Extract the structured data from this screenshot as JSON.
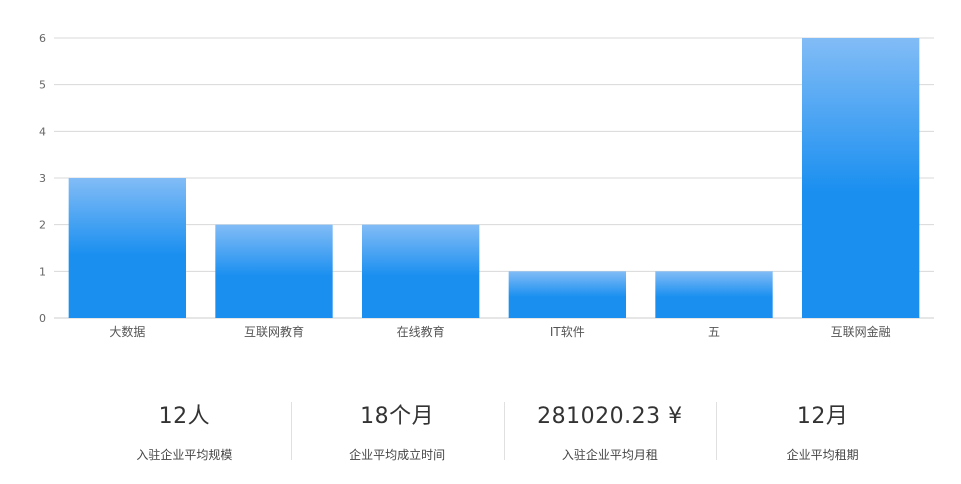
{
  "chart_data": {
    "type": "bar",
    "categories": [
      "大数据",
      "互联网教育",
      "在线教育",
      "IT软件",
      "五",
      "互联网金融"
    ],
    "values": [
      3,
      2,
      2,
      1,
      1,
      6
    ],
    "ylim": [
      0,
      6
    ],
    "yticks": [
      "0",
      "1",
      "2",
      "3",
      "4",
      "5",
      "6"
    ],
    "grid": true,
    "colors": {
      "bar_top": "#82bcf6",
      "bar_bottom": "#1a8ff0",
      "grid": "#d8d8d8",
      "axis": "#cccccc"
    }
  },
  "stats": [
    {
      "value": "12人",
      "label": "入驻企业平均规模"
    },
    {
      "value": "18个月",
      "label": "企业平均成立时间"
    },
    {
      "value": "281020.23 ¥",
      "label": "入驻企业平均月租"
    },
    {
      "value": "12月",
      "label": "企业平均租期"
    }
  ]
}
